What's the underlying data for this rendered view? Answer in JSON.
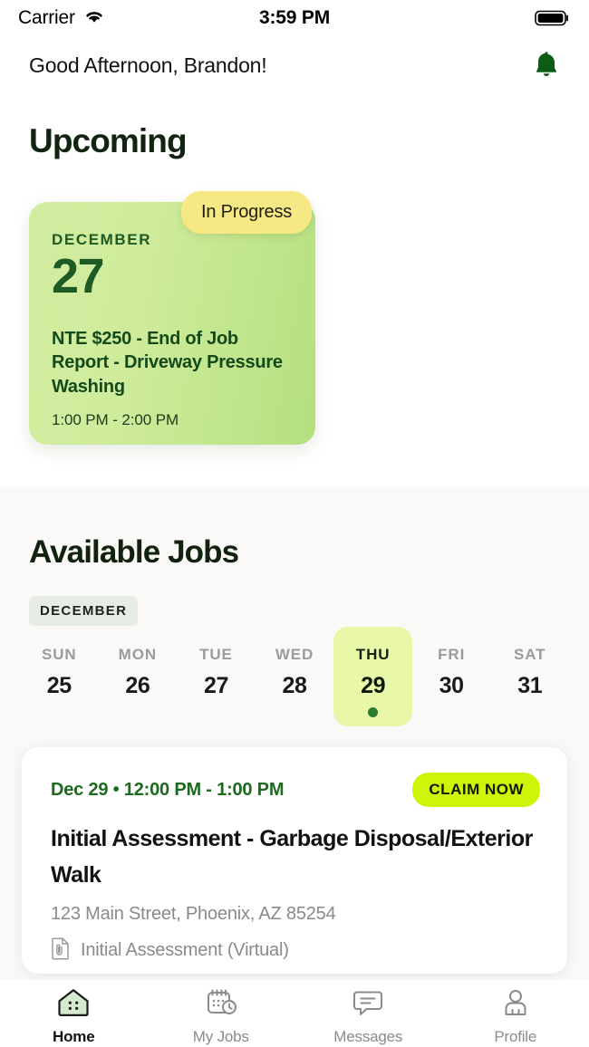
{
  "status_bar": {
    "carrier": "Carrier",
    "time": "3:59 PM",
    "wifi_icon": "wifi-icon",
    "battery_icon": "battery-full-icon"
  },
  "header": {
    "greeting": "Good Afternoon, Brandon!",
    "notification_icon": "bell-icon"
  },
  "upcoming": {
    "heading": "Upcoming",
    "card": {
      "status_pill": "In Progress",
      "month": "DECEMBER",
      "day": "27",
      "title": "NTE $250 - End of Job Report - Driveway Pressure Washing",
      "time_range": "1:00 PM - 2:00 PM"
    }
  },
  "available": {
    "heading": "Available Jobs",
    "month_chip": "DECEMBER",
    "calendar": [
      {
        "weekday": "SUN",
        "day": "25",
        "selected": false,
        "has_event": false
      },
      {
        "weekday": "MON",
        "day": "26",
        "selected": false,
        "has_event": false
      },
      {
        "weekday": "TUE",
        "day": "27",
        "selected": false,
        "has_event": false
      },
      {
        "weekday": "WED",
        "day": "28",
        "selected": false,
        "has_event": false
      },
      {
        "weekday": "THU",
        "day": "29",
        "selected": true,
        "has_event": true
      },
      {
        "weekday": "FRI",
        "day": "30",
        "selected": false,
        "has_event": false
      },
      {
        "weekday": "SAT",
        "day": "31",
        "selected": false,
        "has_event": false
      }
    ],
    "jobs": [
      {
        "when": "Dec 29 • 12:00 PM - 1:00 PM",
        "claim_label": "CLAIM NOW",
        "title": "Initial Assessment - Garbage Disposal/Exterior Walk",
        "address": "123 Main Street, Phoenix, AZ 85254",
        "type": "Initial Assessment (Virtual)",
        "type_icon": "document-attachment-icon"
      }
    ]
  },
  "tabbar": {
    "tabs": [
      {
        "label": "Home",
        "icon": "house-icon",
        "active": true
      },
      {
        "label": "My Jobs",
        "icon": "calendar-clock-icon",
        "active": false
      },
      {
        "label": "Messages",
        "icon": "chat-bubble-icon",
        "active": false
      },
      {
        "label": "Profile",
        "icon": "person-icon",
        "active": false
      }
    ]
  },
  "colors": {
    "accent_lime": "#ccf507",
    "card_green_start": "#d3eda0",
    "card_green_end": "#b4e07f",
    "status_yellow": "#f6e985",
    "selected_day": "#e9f8a8",
    "dark_green": "#1e5a23",
    "section_bg": "#faf9f7"
  }
}
